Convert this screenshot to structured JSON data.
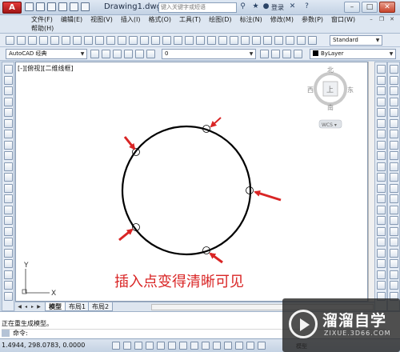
{
  "titlebar": {
    "app_logo": "A",
    "title": "Drawing1.dwg",
    "search_placeholder": "键入关键字或短语",
    "login": "登录",
    "minimize": "–",
    "maximize": "□",
    "close": "✕"
  },
  "menu": {
    "row1": [
      "文件(F)",
      "编辑(E)",
      "视图(V)",
      "插入(I)",
      "格式(O)",
      "工具(T)",
      "绘图(D)",
      "标注(N)",
      "修改(M)",
      "参数(P)",
      "窗口(W)"
    ],
    "row2": [
      "帮助(H)"
    ]
  },
  "toolbar2": {
    "style_combo": "Standard"
  },
  "toolbar3": {
    "workspace_combo": "AutoCAD 经典",
    "layer_combo": "0",
    "color_combo": "ByLayer"
  },
  "viewport": {
    "label": "[-][俯视][二维线框]"
  },
  "viewcube": {
    "north": "北",
    "south": "南",
    "east": "东",
    "west": "西",
    "top": "上",
    "wcs": "WCS ▾"
  },
  "annotation": {
    "text": "插入点变得清晰可见",
    "color": "#d92525"
  },
  "ucs": {
    "x": "X",
    "y": "Y"
  },
  "tabs": [
    "模型",
    "布局1",
    "布局2"
  ],
  "command": {
    "output": "正在重生成模型。",
    "prompt": "命令:"
  },
  "status": {
    "coords": "1.4944,  298.0783,  0.0000",
    "model_label": "模型"
  },
  "watermark": {
    "title": "溜溜自学",
    "url": "ZIXUE.3D66.COM"
  }
}
